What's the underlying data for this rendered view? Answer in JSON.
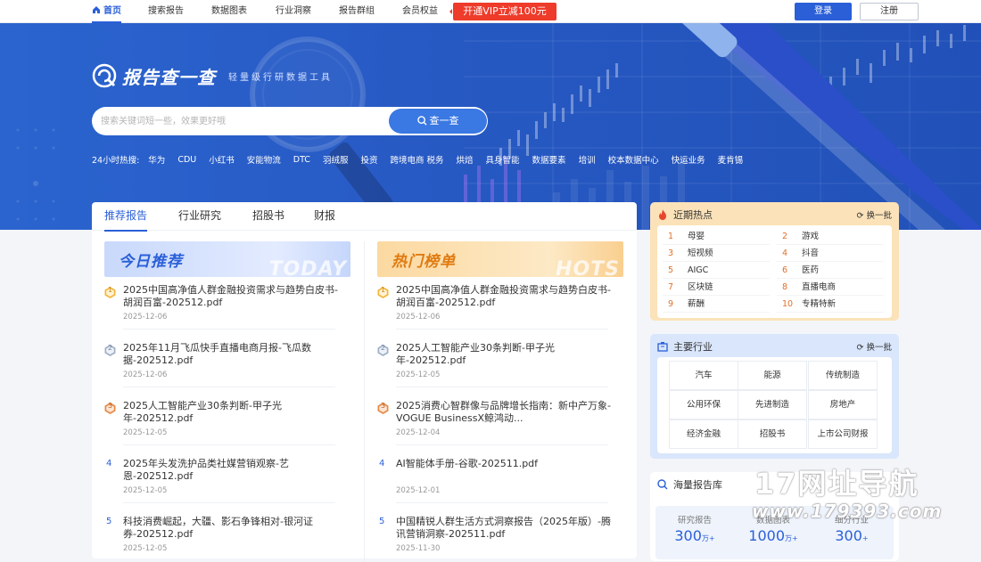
{
  "nav": {
    "items": [
      "首页",
      "搜索报告",
      "数据图表",
      "行业洞察",
      "报告群组",
      "会员权益"
    ],
    "vip": "开通VIP立减100元",
    "login": "登录",
    "register": "注册"
  },
  "hero": {
    "logo_text": "报告查一查",
    "logo_sub": "轻量级行研数据工具",
    "search_placeholder": "搜索关键词短一些，效果更好哦",
    "search_button": "查一查",
    "hot_label": "24小时热搜:",
    "hot_terms": [
      "华为",
      "CDU",
      "小红书",
      "安能物流",
      "DTC",
      "羽绒服",
      "投资",
      "跨境电商 税务",
      "烘焙",
      "具身智能",
      "数据要素",
      "培训",
      "校本数据中心",
      "快运业务",
      "麦肯锡"
    ]
  },
  "tabs": [
    "推荐报告",
    "行业研究",
    "招股书",
    "财报"
  ],
  "today": {
    "title": "今日推荐",
    "en": "TODAY",
    "items": [
      {
        "rank": "1",
        "title": "2025中国高净值人群金融投资需求与趋势白皮书-胡润百富-202512.pdf",
        "date": "2025-12-06"
      },
      {
        "rank": "2",
        "title": "2025年11月飞瓜快手直播电商月报-飞瓜数据-202512.pdf",
        "date": "2025-12-06"
      },
      {
        "rank": "3",
        "title": "2025人工智能产业30条判断-甲子光年-202512.pdf",
        "date": "2025-12-05"
      },
      {
        "rank": "4",
        "title": "2025年头发洗护品类社媒营销观察-艺恩-202512.pdf",
        "date": "2025-12-05"
      },
      {
        "rank": "5",
        "title": "科技消费崛起，大疆、影石争锋相对-银河证券-202512.pdf",
        "date": "2025-12-05"
      }
    ]
  },
  "hots": {
    "title": "热门榜单",
    "en": "HOTS",
    "items": [
      {
        "rank": "1",
        "title": "2025中国高净值人群金融投资需求与趋势白皮书-胡润百富-202512.pdf",
        "date": "2025-12-06"
      },
      {
        "rank": "2",
        "title": "2025人工智能产业30条判断-甲子光年-202512.pdf",
        "date": "2025-12-05"
      },
      {
        "rank": "3",
        "title": "2025消费心智群像与品牌增长指南：新中产万象-VOGUE BusinessX鲸鸿动...",
        "date": "2025-12-04"
      },
      {
        "rank": "4",
        "title": "AI智能体手册-谷歌-202511.pdf",
        "date": "2025-12-01"
      },
      {
        "rank": "5",
        "title": "中国精锐人群生活方式洞察报告（2025年版）-腾讯营销洞察-202511.pdf",
        "date": "2025-11-30"
      }
    ]
  },
  "recent_hot": {
    "title": "近期热点",
    "refresh": "换一批",
    "items": [
      {
        "n": "1",
        "t": "母婴"
      },
      {
        "n": "2",
        "t": "游戏"
      },
      {
        "n": "3",
        "t": "短视频"
      },
      {
        "n": "4",
        "t": "抖音"
      },
      {
        "n": "5",
        "t": "AIGC"
      },
      {
        "n": "6",
        "t": "医药"
      },
      {
        "n": "7",
        "t": "区块链"
      },
      {
        "n": "8",
        "t": "直播电商"
      },
      {
        "n": "9",
        "t": "薪酬"
      },
      {
        "n": "10",
        "t": "专精特新"
      }
    ]
  },
  "industries": {
    "title": "主要行业",
    "refresh": "换一批",
    "items": [
      "汽车",
      "能源",
      "传统制造",
      "公用环保",
      "先进制造",
      "房地产",
      "经济金融",
      "招股书",
      "上市公司财报"
    ]
  },
  "library": {
    "title": "海量报告库",
    "stats": [
      {
        "label": "研究报告",
        "value": "300",
        "unit": "万+"
      },
      {
        "label": "数据图表",
        "value": "1000",
        "unit": "万+"
      },
      {
        "label": "细分行业",
        "value": "300",
        "unit": "+"
      }
    ]
  },
  "watermark": {
    "line1": "17网址导航",
    "line2": "www.179393.com"
  },
  "colors": {
    "brand": "#2a5fd8",
    "vip": "#ee3b2a",
    "hot_accent": "#e0702a"
  }
}
